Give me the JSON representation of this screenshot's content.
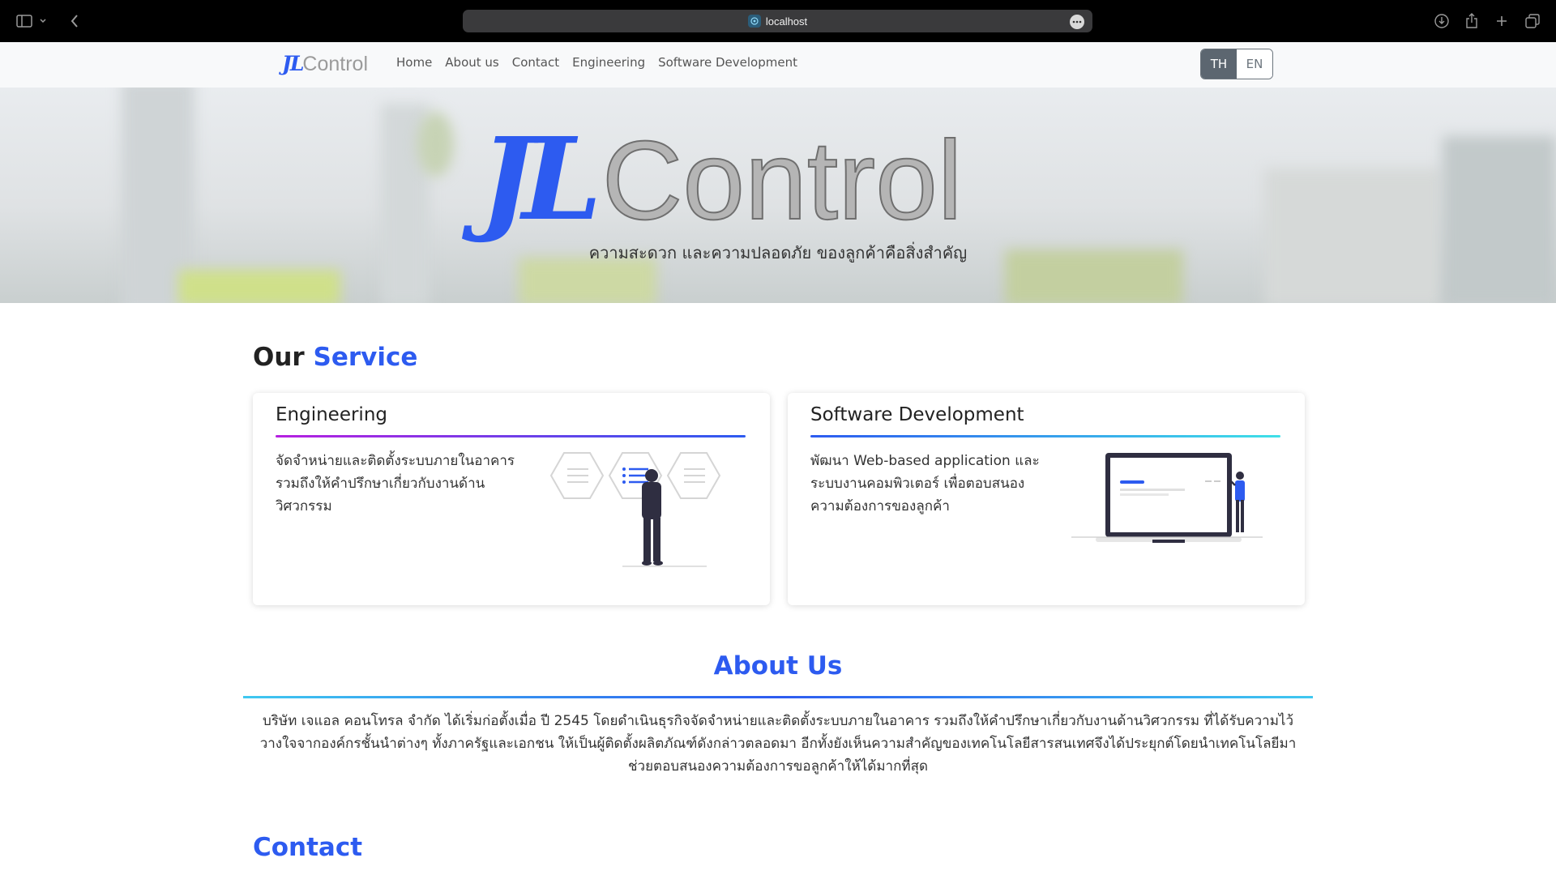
{
  "browser": {
    "url": "localhost",
    "icons": [
      "sidebar-toggle-icon",
      "chevron-down-icon",
      "back-arrow-icon",
      "more-icon",
      "download-icon",
      "share-icon",
      "plus-icon",
      "tabs-overview-icon"
    ]
  },
  "navbar": {
    "logo": {
      "jl": "JL",
      "control": "Control"
    },
    "links": [
      "Home",
      "About us",
      "Contact",
      "Engineering",
      "Software Development"
    ],
    "lang": {
      "th": "TH",
      "en": "EN",
      "active": "TH"
    }
  },
  "hero": {
    "logo": {
      "jl": "JL",
      "control": "Control"
    },
    "tagline": "ความสะดวก และความปลอดภัย ของลูกค้าคือสิ่งสำคัญ"
  },
  "service": {
    "title_part1": "Our",
    "title_part2": "Service",
    "cards": [
      {
        "title": "Engineering",
        "description": "จัดจำหน่ายและติดตั้งระบบภายในอาคาร รวมถึงให้คำปรึกษาเกี่ยวกับงานด้านวิศวกรรม"
      },
      {
        "title": "Software Development",
        "description": "พัฒนา Web-based application และระบบงานคอมพิวเตอร์ เพื่อตอบสนองความต้องการของลูกค้า"
      }
    ]
  },
  "about": {
    "title": "About Us",
    "text": "บริษัท เจแอล คอนโทรล จำกัด ได้เริ่มก่อตั้งเมื่อ ปี 2545 โดยดำเนินธุรกิจจัดจำหน่ายและติดตั้งระบบภายในอาคาร รวมถึงให้คำปรึกษาเกี่ยวกับงานด้านวิศวกรรม ที่ได้รับความไว้วางใจจากองค์กรชั้นนำต่างๆ ทั้งภาครัฐและเอกชน ให้เป็นผู้ติดตั้งผลิตภัณฑ์ดังกล่าวตลอดมา อีกทั้งยังเห็นความสำคัญของเทคโนโลยีสารสนเทศจึงได้ประยุกต์โดยนำเทคโนโลยีมาช่วยตอบสนองความต้องการขอลูกค้าให้ได้มากที่สุด"
  },
  "contact": {
    "title": "Contact"
  },
  "colors": {
    "accent": "#2d5bf0",
    "nav_bg": "#f8f9fa",
    "chrome_bg": "#000000"
  }
}
